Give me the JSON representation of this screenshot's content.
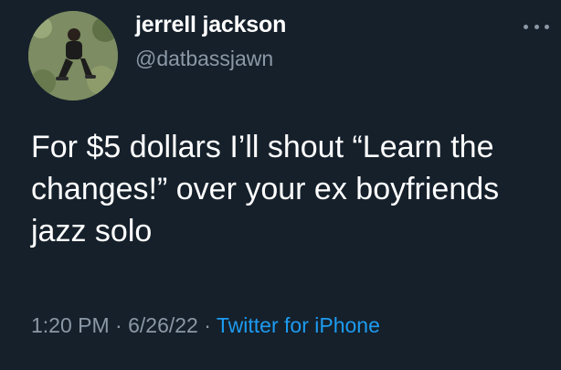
{
  "tweet": {
    "author_name": "jerrell jackson",
    "author_handle": "@datbassjawn",
    "text": "For $5 dollars I’ll shout “Learn the changes!” over your ex boyfriends jazz solo",
    "time": "1:20 PM",
    "separator": " · ",
    "date": "6/26/22",
    "source": "Twitter for iPhone",
    "more_icon": "more-horizontal-icon"
  },
  "colors": {
    "background": "#15202b",
    "primary_text": "#ffffff",
    "secondary_text": "#8b98a5",
    "link": "#1d9bf0"
  }
}
